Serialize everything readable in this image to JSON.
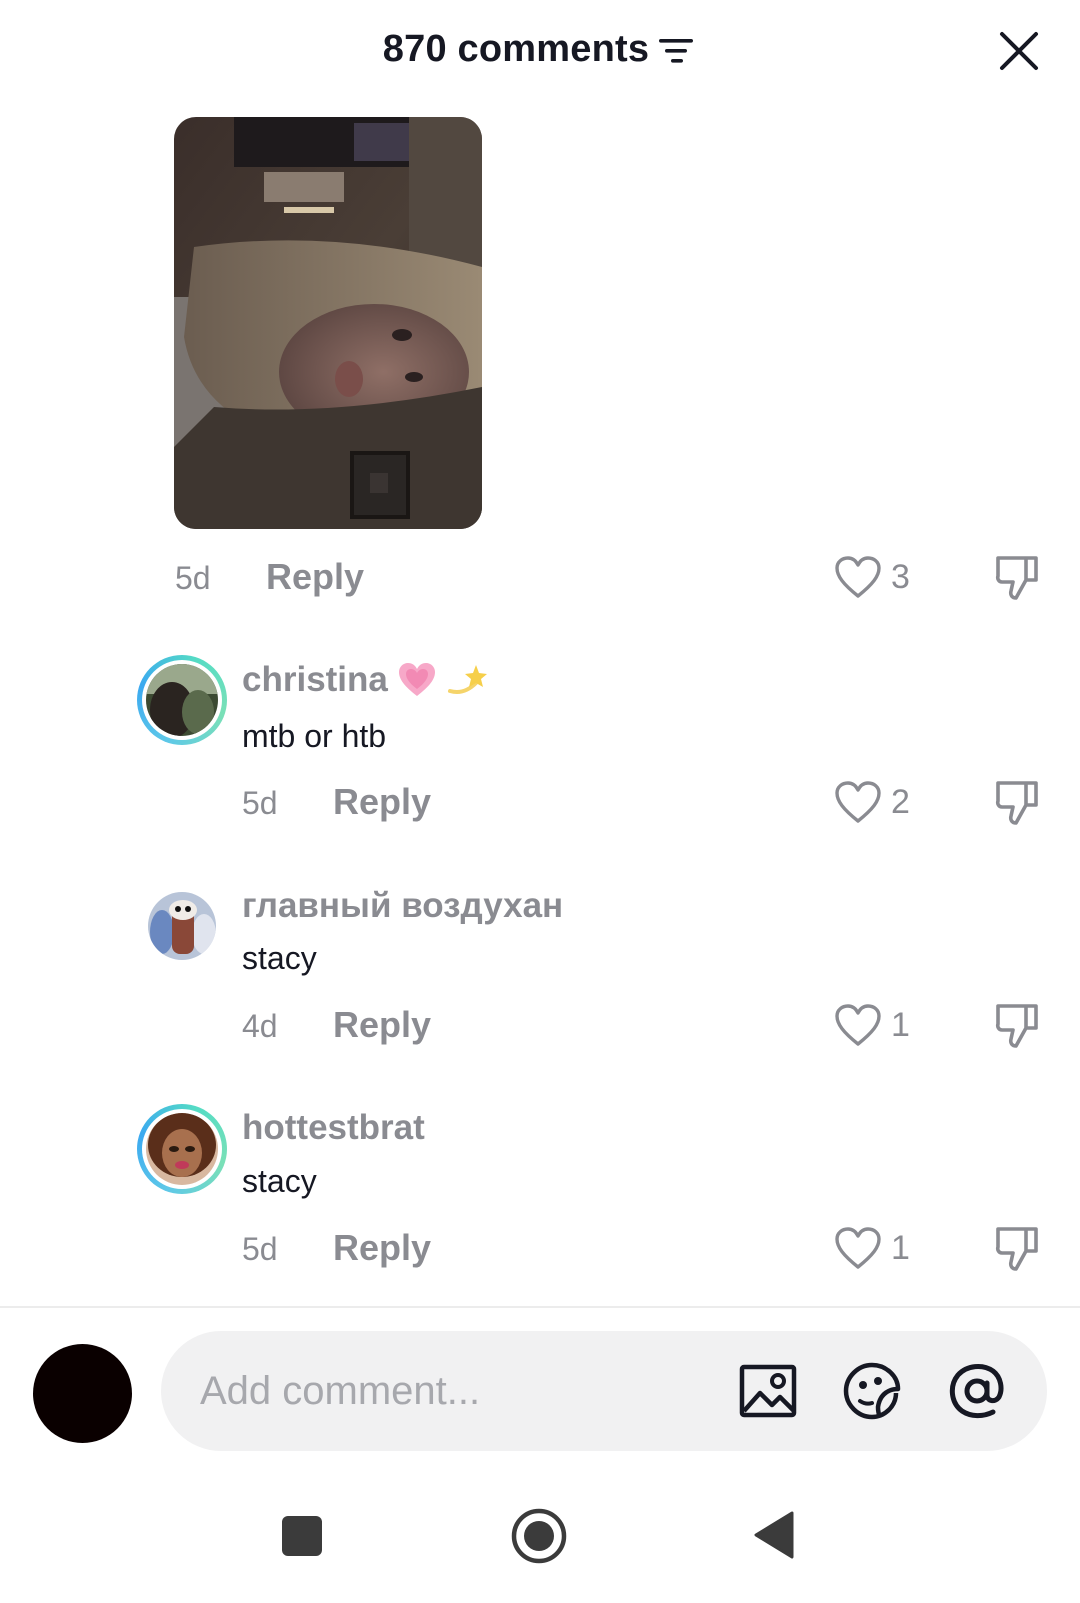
{
  "header": {
    "title": "870 comments",
    "sort_icon": "sort-icon",
    "close_icon": "close-icon"
  },
  "photo_reply": {
    "time": "5d",
    "reply_label": "Reply",
    "likes": "3"
  },
  "comments": [
    {
      "username": "christina",
      "emoji": [
        "pink-heart",
        "dizzy-star"
      ],
      "text": "mtb or htb",
      "time": "5d",
      "reply_label": "Reply",
      "likes": "2",
      "avatar_ring": true
    },
    {
      "username": "главный воздухан",
      "text": "stacy",
      "time": "4d",
      "reply_label": "Reply",
      "likes": "1",
      "avatar_ring": false
    },
    {
      "username": "hottestbrat",
      "text": "stacy",
      "time": "5d",
      "reply_label": "Reply",
      "likes": "1",
      "avatar_ring": true
    }
  ],
  "composer": {
    "placeholder": "Add comment...",
    "icons": [
      "image-icon",
      "emoji-sticker-icon",
      "mention-icon"
    ]
  },
  "navbar": {
    "icons": [
      "recents-icon",
      "home-icon",
      "back-icon"
    ]
  },
  "colors": {
    "text": "#161823",
    "muted": "#8a8b91",
    "pill": "#f1f1f2",
    "ring": "#3ba9f0"
  }
}
